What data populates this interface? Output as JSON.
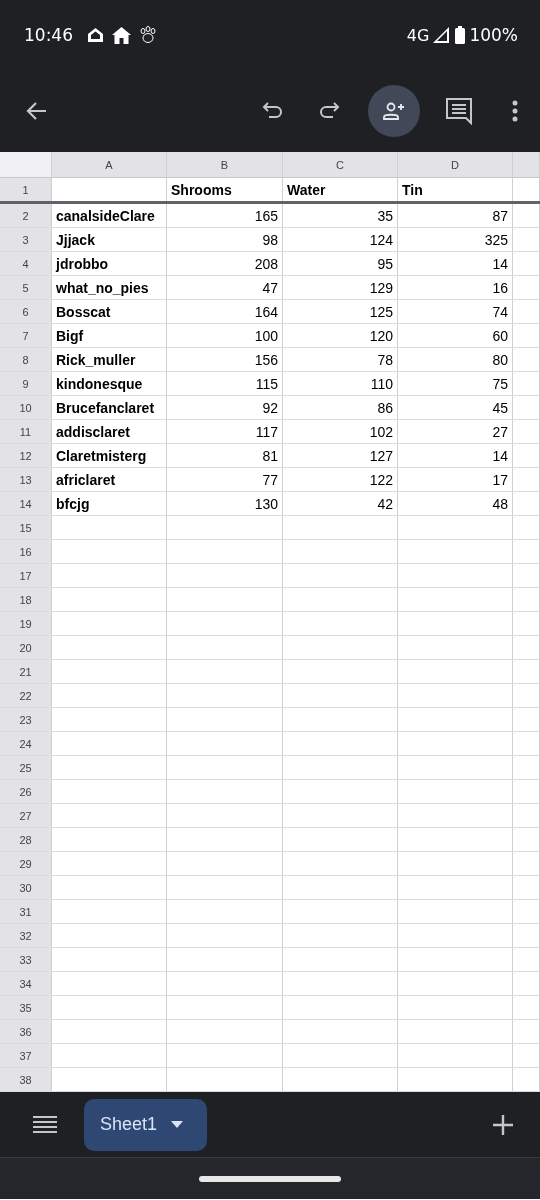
{
  "status_bar": {
    "time": "10:46",
    "network": "4G",
    "battery": "100%"
  },
  "columns": [
    "A",
    "B",
    "C",
    "D"
  ],
  "header_row": {
    "number": "1",
    "b": "Shrooms",
    "c": "Water",
    "d": "Tin"
  },
  "rows": [
    {
      "number": "2",
      "a": "canalsideClare",
      "b": "165",
      "c": "35",
      "d": "87"
    },
    {
      "number": "3",
      "a": "Jjjack",
      "b": "98",
      "c": "124",
      "d": "325"
    },
    {
      "number": "4",
      "a": "jdrobbo",
      "b": "208",
      "c": "95",
      "d": "14"
    },
    {
      "number": "5",
      "a": "what_no_pies",
      "b": "47",
      "c": "129",
      "d": "16"
    },
    {
      "number": "6",
      "a": "Bosscat",
      "b": "164",
      "c": "125",
      "d": "74"
    },
    {
      "number": "7",
      "a": "Bigf",
      "b": "100",
      "c": "120",
      "d": "60"
    },
    {
      "number": "8",
      "a": "Rick_muller",
      "b": "156",
      "c": "78",
      "d": "80"
    },
    {
      "number": "9",
      "a": "kindonesque",
      "b": "115",
      "c": "110",
      "d": "75"
    },
    {
      "number": "10",
      "a": "Brucefanclaret",
      "b": "92",
      "c": "86",
      "d": "45"
    },
    {
      "number": "11",
      "a": "addisclaret",
      "b": "117",
      "c": "102",
      "d": "27"
    },
    {
      "number": "12",
      "a": "Claretmisterg",
      "b": "81",
      "c": "127",
      "d": "14"
    },
    {
      "number": "13",
      "a": "africlaret",
      "b": "77",
      "c": "122",
      "d": "17"
    },
    {
      "number": "14",
      "a": "bfcjg",
      "b": "130",
      "c": "42",
      "d": "48"
    },
    {
      "number": "15"
    },
    {
      "number": "16"
    },
    {
      "number": "17"
    },
    {
      "number": "18"
    },
    {
      "number": "19"
    },
    {
      "number": "20"
    },
    {
      "number": "21"
    },
    {
      "number": "22"
    },
    {
      "number": "23"
    },
    {
      "number": "24"
    },
    {
      "number": "25"
    },
    {
      "number": "26"
    },
    {
      "number": "27"
    },
    {
      "number": "28"
    },
    {
      "number": "29"
    },
    {
      "number": "30"
    },
    {
      "number": "31"
    },
    {
      "number": "32"
    },
    {
      "number": "33"
    },
    {
      "number": "34"
    },
    {
      "number": "35"
    },
    {
      "number": "36"
    },
    {
      "number": "37"
    },
    {
      "number": "38"
    }
  ],
  "sheet_tabs": [
    {
      "label": "Sheet1",
      "selected": true
    }
  ]
}
